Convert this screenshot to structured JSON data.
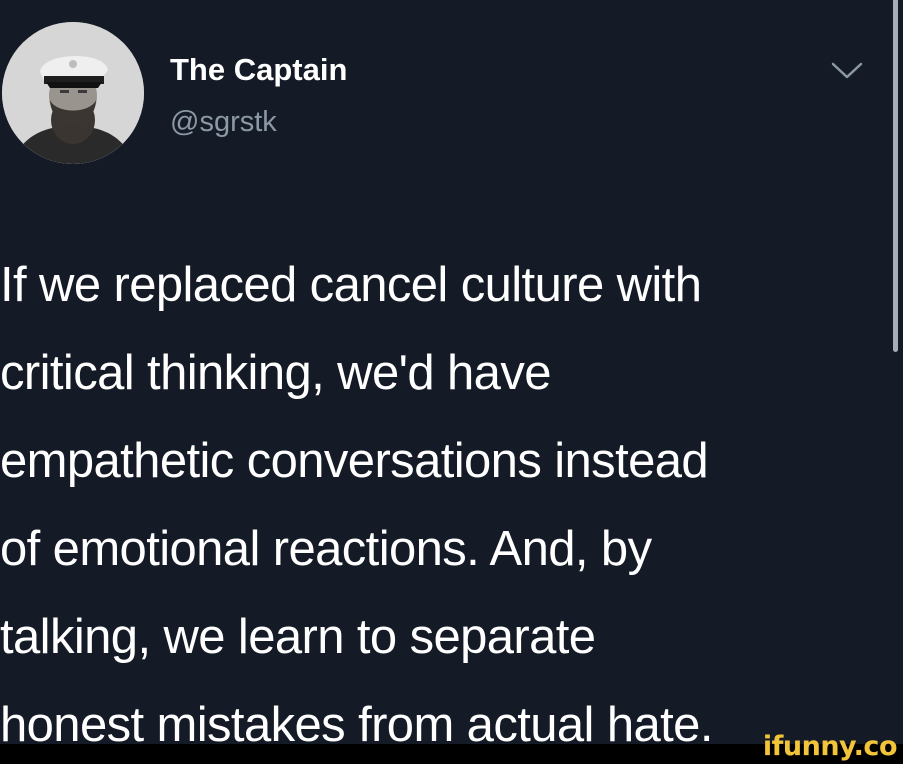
{
  "tweet": {
    "author": {
      "display_name": "The Captain",
      "handle": "@sgrstk"
    },
    "menu_icon": "chevron-down-icon",
    "text": "If we replaced cancel culture with\ncritical thinking, we'd have\nempathetic conversations instead\nof emotional reactions. And, by\ntalking, we learn to separate\nhonest mistakes from actual hate."
  },
  "watermark": {
    "text": "ifunny.co"
  },
  "colors": {
    "background": "#151b26",
    "text": "#ffffff",
    "handle": "#8b98a5",
    "watermark": "#f2c43a"
  }
}
